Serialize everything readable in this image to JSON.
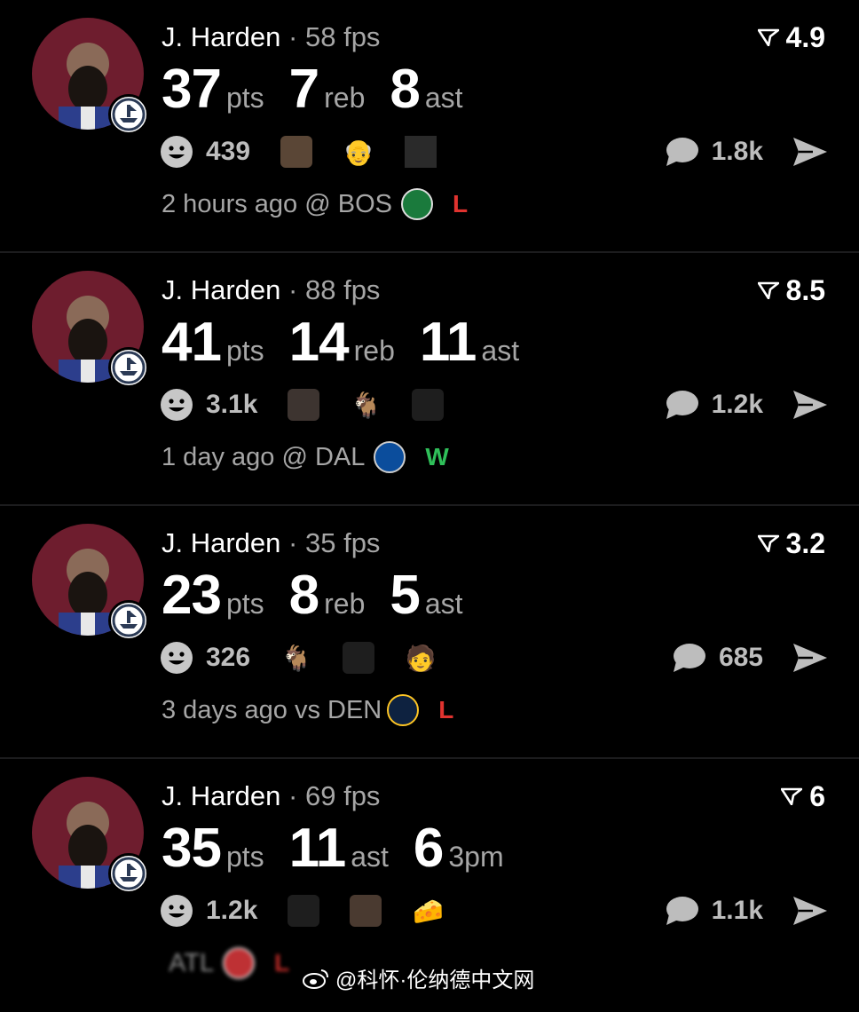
{
  "colors": {
    "loss": "#e0332f",
    "win": "#2fbf59",
    "avatar_bg": "#6e1d2e",
    "muted": "#a6a6a6"
  },
  "posts": [
    {
      "name": "J. Harden",
      "separator": "·",
      "fps": "58 fps",
      "rating": "4.9",
      "stats": [
        {
          "num": "37",
          "unit": "pts"
        },
        {
          "num": "7",
          "unit": "reb"
        },
        {
          "num": "8",
          "unit": "ast"
        }
      ],
      "reaction_count": "439",
      "reactions": [
        "player-face-icon",
        "bald-face-emoji",
        "dunk-icon"
      ],
      "comment_count": "1.8k",
      "time": "2 hours ago",
      "venue": "@ BOS",
      "team_logo": "celtics-logo",
      "result": "L"
    },
    {
      "name": "J. Harden",
      "separator": "·",
      "fps": "88 fps",
      "rating": "8.5",
      "stats": [
        {
          "num": "41",
          "unit": "pts"
        },
        {
          "num": "14",
          "unit": "reb"
        },
        {
          "num": "11",
          "unit": "ast"
        }
      ],
      "reaction_count": "3.1k",
      "reactions": [
        "beard-face-icon",
        "goat-emoji",
        "hooded-face-icon"
      ],
      "comment_count": "1.2k",
      "time": "1 day ago",
      "venue": "@ DAL",
      "team_logo": "mavericks-logo",
      "result": "W"
    },
    {
      "name": "J. Harden",
      "separator": "·",
      "fps": "35 fps",
      "rating": "3.2",
      "stats": [
        {
          "num": "23",
          "unit": "pts"
        },
        {
          "num": "8",
          "unit": "reb"
        },
        {
          "num": "5",
          "unit": "ast"
        }
      ],
      "reaction_count": "326",
      "reactions": [
        "goat-emoji",
        "hooded-face-icon",
        "person-emoji"
      ],
      "comment_count": "685",
      "time": "3 days ago",
      "venue": "vs DEN",
      "team_logo": "nuggets-logo",
      "result": "L"
    },
    {
      "name": "J. Harden",
      "separator": "·",
      "fps": "69 fps",
      "rating": "6",
      "stats": [
        {
          "num": "35",
          "unit": "pts"
        },
        {
          "num": "11",
          "unit": "ast"
        },
        {
          "num": "6",
          "unit": "3pm"
        }
      ],
      "reaction_count": "1.2k",
      "reactions": [
        "hooded-face-icon",
        "player-face-icon",
        "cheese-emoji"
      ],
      "comment_count": "1.1k",
      "time": "",
      "venue": "ATL",
      "team_logo": "hawks-logo",
      "result": "L"
    }
  ],
  "watermark": {
    "text": "@科怀·伦纳德中文网"
  }
}
